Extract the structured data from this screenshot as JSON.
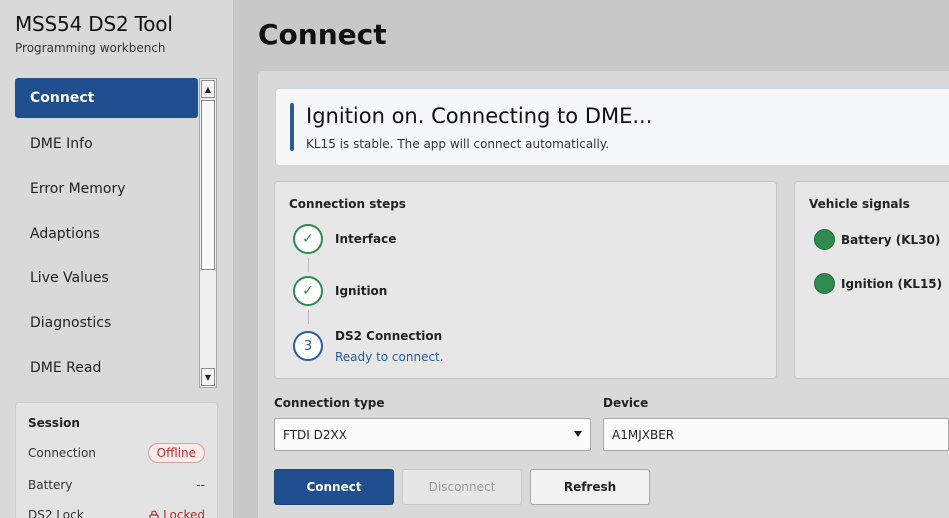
{
  "app": {
    "title": "MSS54 DS2 Tool",
    "subtitle": "Programming workbench"
  },
  "sidebar": {
    "items": [
      {
        "label": "Connect",
        "active": true
      },
      {
        "label": "DME Info",
        "active": false
      },
      {
        "label": "Error Memory",
        "active": false
      },
      {
        "label": "Adaptions",
        "active": false
      },
      {
        "label": "Live Values",
        "active": false
      },
      {
        "label": "Diagnostics",
        "active": false
      },
      {
        "label": "DME Read",
        "active": false
      }
    ]
  },
  "session": {
    "title": "Session",
    "connection_label": "Connection",
    "connection_value": "Offline",
    "battery_label": "Battery",
    "battery_value": "--",
    "lock_label": "DS2 Lock",
    "lock_value": "Locked"
  },
  "page": {
    "title": "Connect"
  },
  "banner": {
    "title": "Ignition on. Connecting to DME...",
    "subtitle": "KL15 is stable. The app will connect automatically."
  },
  "steps": {
    "title": "Connection steps",
    "items": [
      {
        "label": "Interface",
        "state": "done",
        "marker": "✓"
      },
      {
        "label": "Ignition",
        "state": "done",
        "marker": "✓"
      },
      {
        "label": "DS2 Connection",
        "state": "pending",
        "marker": "3",
        "status": "Ready to connect."
      }
    ]
  },
  "signals": {
    "title": "Vehicle signals",
    "items": [
      {
        "label": "Battery (KL30)",
        "color": "#2e8a4e"
      },
      {
        "label": "Ignition (KL15)",
        "color": "#2e8a4e"
      }
    ]
  },
  "form": {
    "connection_type_label": "Connection type",
    "connection_type_value": "FTDI D2XX",
    "device_label": "Device",
    "device_value": "A1MJXBER"
  },
  "buttons": {
    "connect": "Connect",
    "disconnect": "Disconnect",
    "refresh": "Refresh"
  },
  "colors": {
    "accent": "#1f4f8f",
    "success": "#2e8a4e",
    "danger": "#b03030"
  }
}
